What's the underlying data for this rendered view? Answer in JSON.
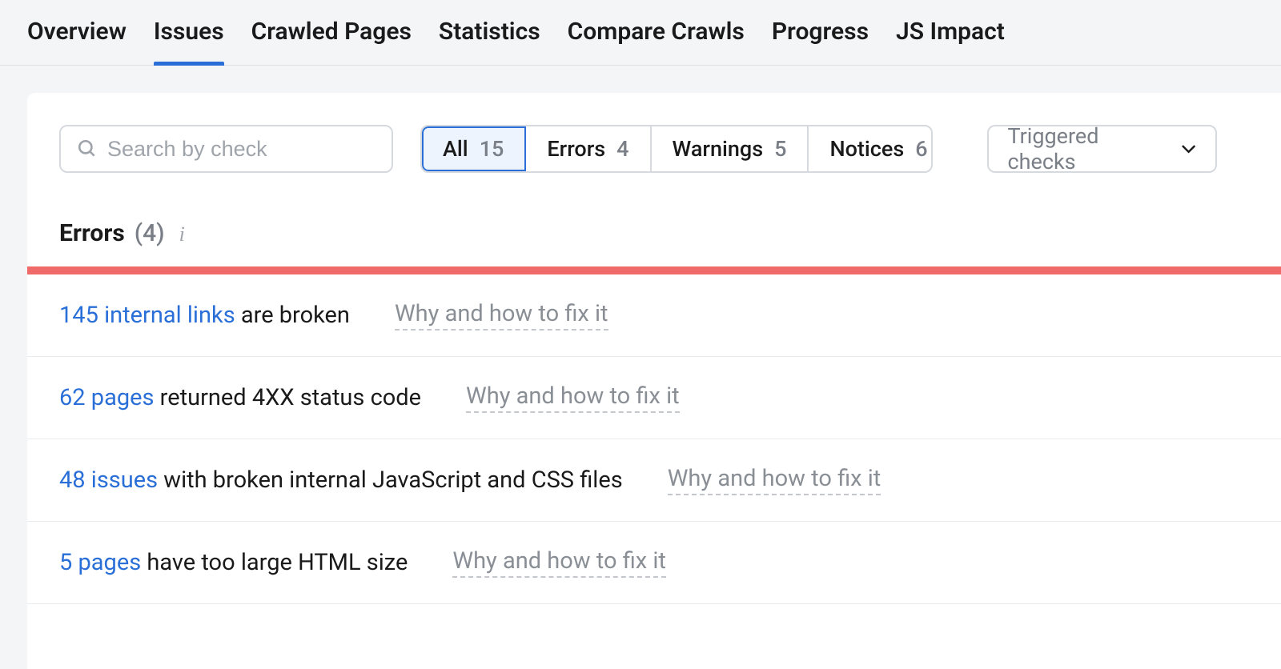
{
  "nav": {
    "tabs": [
      {
        "label": "Overview",
        "active": false
      },
      {
        "label": "Issues",
        "active": true
      },
      {
        "label": "Crawled Pages",
        "active": false
      },
      {
        "label": "Statistics",
        "active": false
      },
      {
        "label": "Compare Crawls",
        "active": false
      },
      {
        "label": "Progress",
        "active": false
      },
      {
        "label": "JS Impact",
        "active": false
      }
    ]
  },
  "search": {
    "placeholder": "Search by check"
  },
  "filters": {
    "items": [
      {
        "label": "All",
        "count": "15",
        "active": true
      },
      {
        "label": "Errors",
        "count": "4",
        "active": false
      },
      {
        "label": "Warnings",
        "count": "5",
        "active": false
      },
      {
        "label": "Notices",
        "count": "6",
        "active": false
      }
    ]
  },
  "dropdown": {
    "label": "Triggered checks"
  },
  "section": {
    "title": "Errors",
    "count": "(4)"
  },
  "fix_label": "Why and how to fix it",
  "issues": [
    {
      "link": "145 internal links",
      "rest": " are broken"
    },
    {
      "link": "62 pages",
      "rest": " returned 4XX status code"
    },
    {
      "link": "48 issues",
      "rest": " with broken internal JavaScript and CSS files"
    },
    {
      "link": "5 pages",
      "rest": " have too large HTML size"
    }
  ]
}
